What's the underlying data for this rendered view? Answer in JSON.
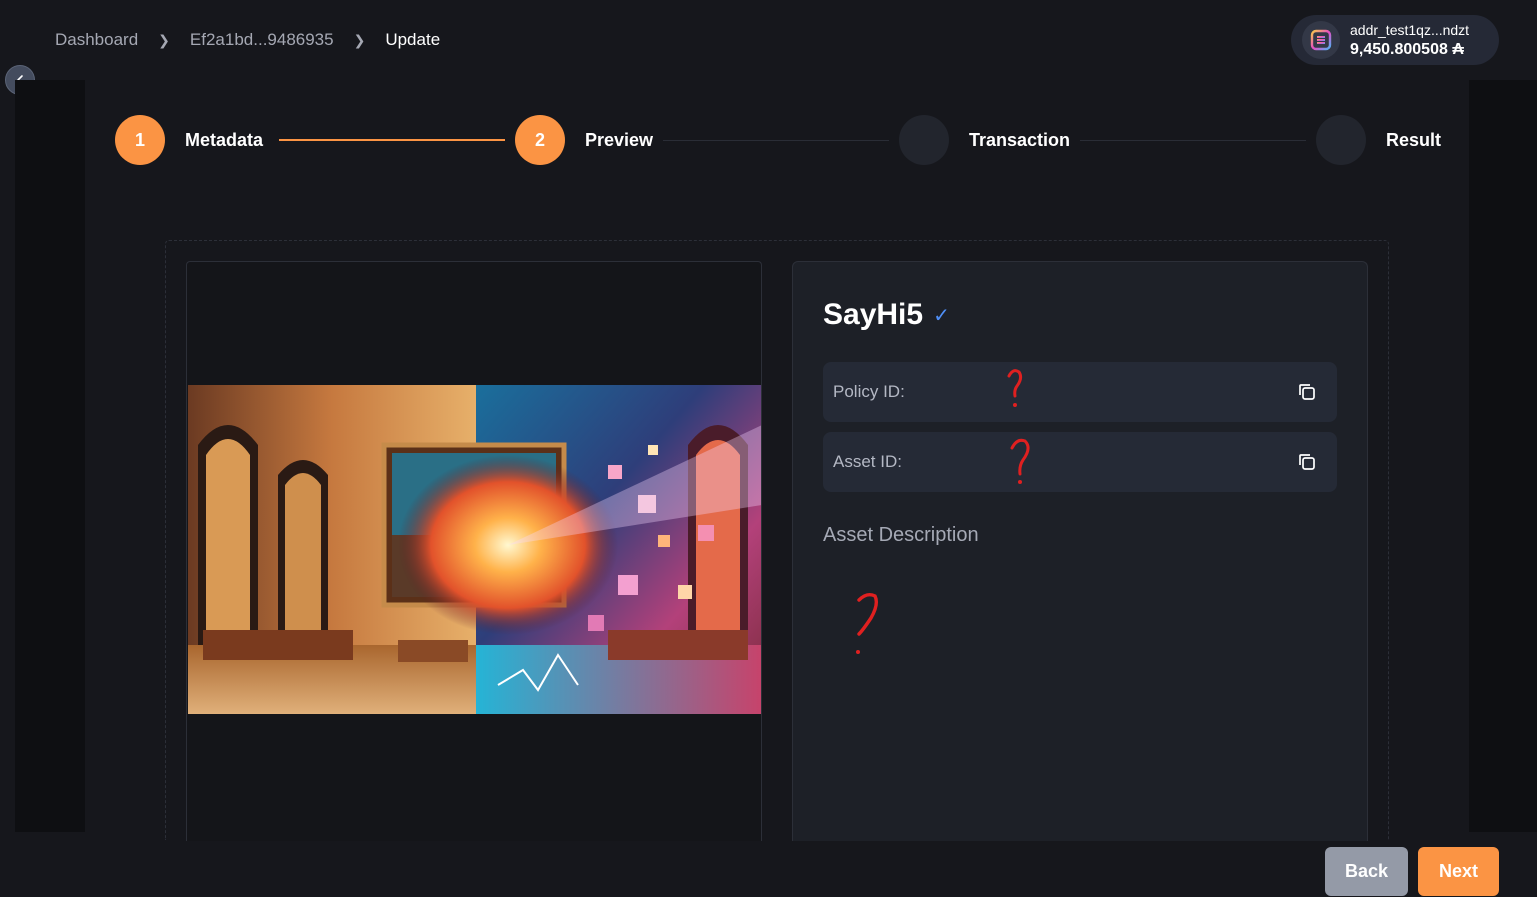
{
  "breadcrumb": {
    "items": [
      "Dashboard",
      "Ef2a1bd...9486935",
      "Update"
    ]
  },
  "wallet": {
    "address": "addr_test1qz...ndzt",
    "balance": "9,450.800508 ₳",
    "icon": "wallet-logo-icon"
  },
  "stepper": {
    "steps": [
      {
        "number": "1",
        "label": "Metadata",
        "state": "completed"
      },
      {
        "number": "2",
        "label": "Preview",
        "state": "active"
      },
      {
        "number": "",
        "label": "Transaction",
        "state": "pending"
      },
      {
        "number": "",
        "label": "Result",
        "state": "pending"
      }
    ],
    "active_color": "#fb9444"
  },
  "asset": {
    "name": "SayHi5",
    "verified_mark": "✓",
    "policy_label": "Policy ID:",
    "asset_id_label": "Asset ID:",
    "description_label": "Asset Description"
  },
  "footer": {
    "back_label": "Back",
    "next_label": "Next"
  }
}
